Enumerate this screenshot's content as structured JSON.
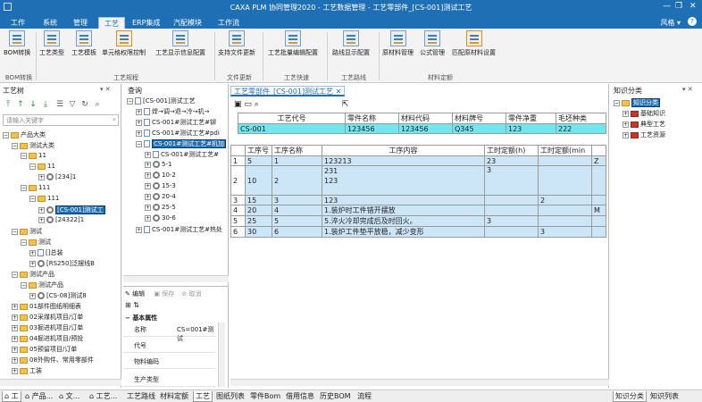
{
  "window": {
    "title": "CAXA PLM 协同管理2020 - 工艺数据管理 - 工艺零部件_[CS-001]测试工艺"
  },
  "menus": [
    {
      "label": "工作"
    },
    {
      "label": "系统"
    },
    {
      "label": "管理"
    },
    {
      "label": "工艺",
      "active": true
    },
    {
      "label": "ERP集成"
    },
    {
      "label": "汽配模块"
    },
    {
      "label": "工作流"
    }
  ],
  "style_label": "风格",
  "help_label": "?",
  "ribbon": {
    "buttons": [
      "BOM转换",
      "工艺类型",
      "工艺模板",
      "单元格权限控制",
      "工艺显示信息配置",
      "支持文件更新",
      "工艺批量编辑配置",
      "路线显示配置",
      "原材料管理",
      "公式管理",
      "匹配原材料设置"
    ],
    "groups": [
      "BOM转换",
      "工艺规程",
      "文件更新",
      "工艺快速",
      "工艺路线",
      "材料定额"
    ]
  },
  "left_panel": {
    "title": "工艺树",
    "search_placeholder": "请输入关键字",
    "tree": [
      {
        "label": "产品大类"
      },
      {
        "label": "测试大类"
      },
      {
        "label": "11"
      },
      {
        "label": "11"
      },
      {
        "label": "[234]1"
      },
      {
        "label": "111"
      },
      {
        "label": "111"
      },
      {
        "label": "[CS-001]测试工"
      },
      {
        "label": "[24322]1"
      },
      {
        "label": "测试"
      },
      {
        "label": "测试"
      },
      {
        "label": "[]总装"
      },
      {
        "label": "[RS250]泛摆线B"
      },
      {
        "label": "测试产品"
      },
      {
        "label": "测试产品"
      },
      {
        "label": "[CS-08]测试8"
      },
      {
        "label": "01部件图纸明细表"
      },
      {
        "label": "02采煤机项目/订单"
      },
      {
        "label": "03掘进机项目/订单"
      },
      {
        "label": "04掘进机项目/预投"
      },
      {
        "label": "05预留项目/订单"
      },
      {
        "label": "08外购件、常用零部件"
      },
      {
        "label": "工装"
      }
    ]
  },
  "mid_panel": {
    "tab": "查询",
    "tree": [
      {
        "label": "[CS-001]测试工艺"
      },
      {
        "label": "焊→调→退→冷→机→"
      },
      {
        "label": "CS-001#测试工艺#铆"
      },
      {
        "label": "CS-001#测试工艺#pdi"
      },
      {
        "label": "CS-001#测试工艺#机加"
      },
      {
        "label": "CS-001#测试工艺#"
      },
      {
        "label": "5-1"
      },
      {
        "label": "10-2"
      },
      {
        "label": "15-3"
      },
      {
        "label": "20-4"
      },
      {
        "label": "25-5"
      },
      {
        "label": "30-6"
      },
      {
        "label": "CS-001#测试工艺#热处"
      }
    ],
    "props_toolbar": {
      "edit": "编辑",
      "save": "保存",
      "cancel": "取消"
    },
    "props_section": "基本属性",
    "props": [
      {
        "key": "名称",
        "value": "CS=001#测试"
      },
      {
        "key": "代号",
        "value": ""
      },
      {
        "key": "物料编码",
        "value": ""
      },
      {
        "key": "生产类型",
        "value": ""
      }
    ]
  },
  "content": {
    "tab": "工艺零部件_[CS-001]测试工艺",
    "header_cols": [
      "工艺代号",
      "零件名称",
      "材料代码",
      "材料牌号",
      "零件净重",
      "毛坯种类"
    ],
    "header_row": [
      "CS-001",
      "123456",
      "123456",
      "Q345",
      "123",
      "222"
    ],
    "op_cols": [
      "工序号",
      "工序名称",
      "工序内容",
      "工时定额(h)",
      "工时定额(min",
      ""
    ],
    "op_rows": [
      {
        "n": "1",
        "cells": [
          "5",
          "1",
          "123213",
          "23",
          "",
          "Z"
        ]
      },
      {
        "n": "2",
        "cells": [
          "10",
          "2",
          "231\n123",
          "3",
          "",
          ""
        ]
      },
      {
        "n": "3",
        "cells": [
          "15",
          "3",
          "123",
          "",
          "2",
          ""
        ]
      },
      {
        "n": "4",
        "cells": [
          "20",
          "4",
          "1.装炉时工件错开摆放",
          "",
          "",
          "M"
        ]
      },
      {
        "n": "5",
        "cells": [
          "25",
          "5",
          "5.淬火冷却完成后及时回火。",
          "3",
          "",
          ""
        ]
      },
      {
        "n": "6",
        "cells": [
          "30",
          "6",
          "1.装炉工件垫平放稳，减少变形",
          "",
          "3",
          ""
        ]
      }
    ]
  },
  "right_panel": {
    "title": "知识分类",
    "tree": [
      {
        "label": "知识分类"
      },
      {
        "label": "基础知识"
      },
      {
        "label": "典型工艺"
      },
      {
        "label": "工艺资源"
      }
    ]
  },
  "bottom_tabs": {
    "left": [
      "工",
      "产品...",
      "文...",
      "工艺..."
    ],
    "content": [
      "工艺路线",
      "材料定额",
      "工艺",
      "图纸列表",
      "零件Bom",
      "借用信息",
      "历史BOM",
      "流程"
    ],
    "right": [
      "知识分类",
      "知识列表"
    ]
  },
  "colors": {
    "title_blue": "#1f6fb4",
    "header_cyan": "#6fe6f0",
    "row_blue": "#cde6f7"
  }
}
